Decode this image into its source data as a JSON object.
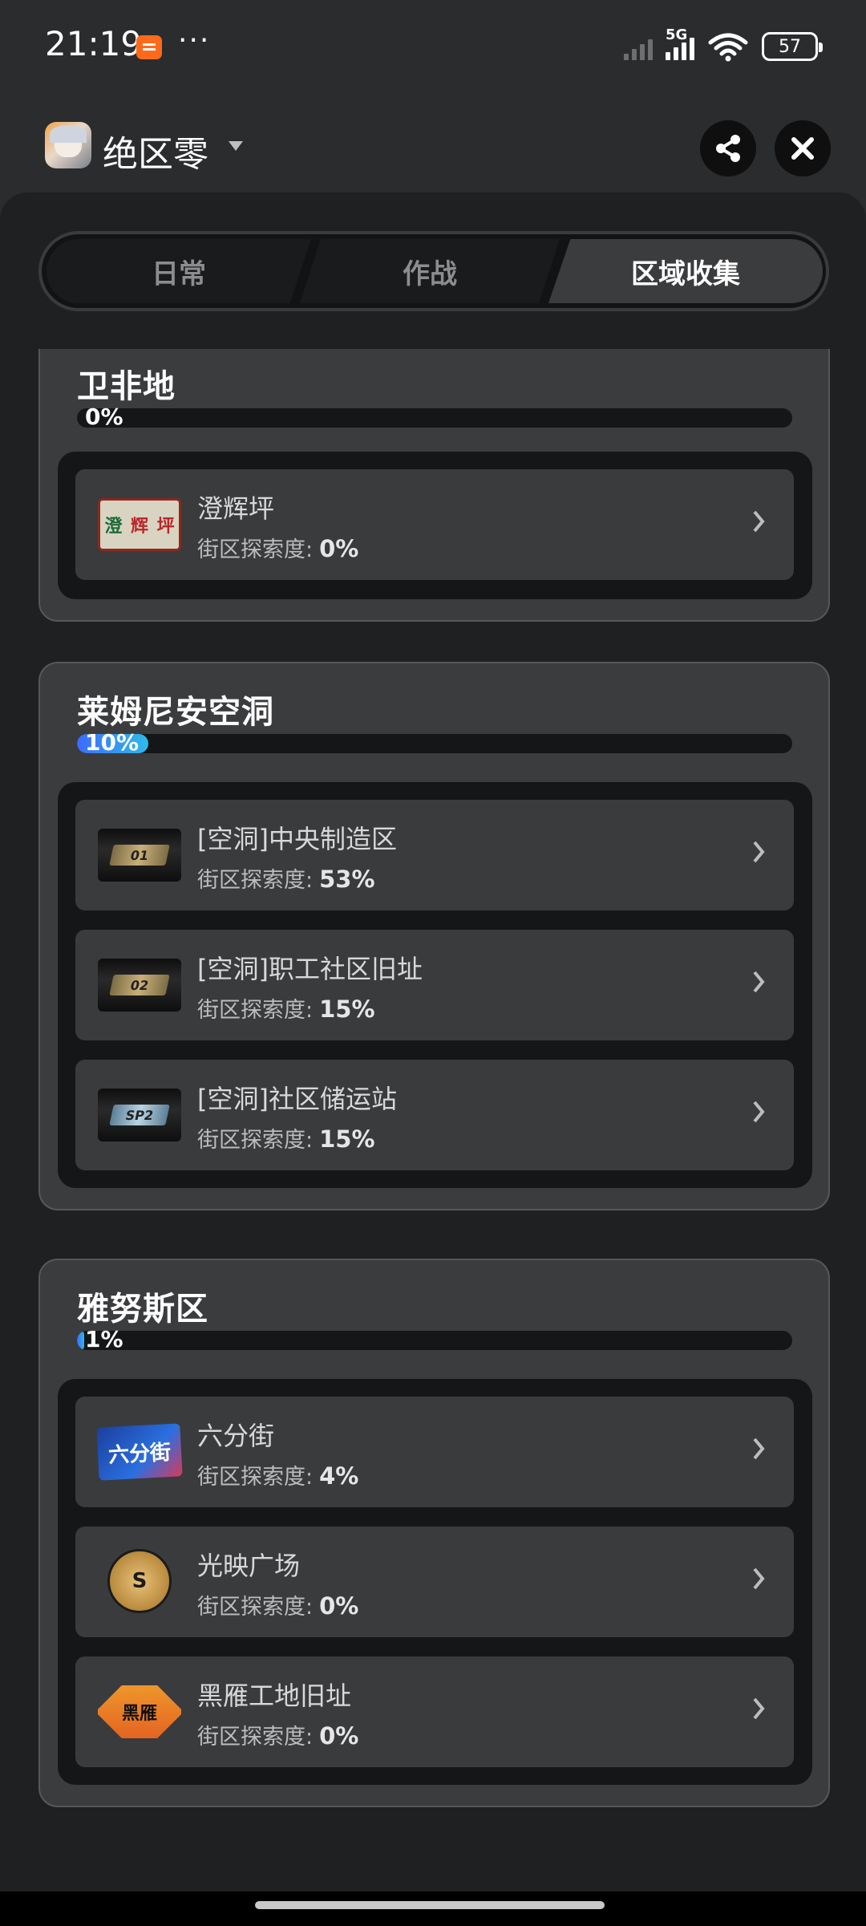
{
  "status_bar": {
    "time": "21:19",
    "dots": "···",
    "network": "5G",
    "battery": "57",
    "icons": [
      "chat-app-icon",
      "signal-icon",
      "wifi-icon",
      "battery-icon"
    ]
  },
  "title_bar": {
    "title": "绝区零",
    "icons": [
      "game-avatar",
      "dropdown-caret-icon",
      "share-icon",
      "close-icon"
    ]
  },
  "tabs": [
    {
      "label": "日常",
      "active": false
    },
    {
      "label": "作战",
      "active": false
    },
    {
      "label": "区域收集",
      "active": true
    }
  ],
  "progress_label_prefix": "街区探索度:",
  "colors": {
    "panel": "#1f2021",
    "card": "#3b3c3e",
    "progress_start": "#3d6bff",
    "progress_end": "#2fb9e8"
  },
  "regions": [
    {
      "name": "卫非地",
      "progress_text": "0%",
      "progress": 0,
      "districts": [
        {
          "name": "澄辉坪",
          "progress": "0%",
          "icon": "chenghui-icon",
          "icon_text": [
            "澄",
            "辉",
            "坪"
          ]
        }
      ]
    },
    {
      "name": "莱姆尼安空洞",
      "progress_text": "10%",
      "progress": 0.1,
      "districts": [
        {
          "name": "[空洞]中央制造区",
          "progress": "53%",
          "icon": "hollow-zone-icon",
          "icon_text": "01"
        },
        {
          "name": "[空洞]职工社区旧址",
          "progress": "15%",
          "icon": "hollow-zone-icon",
          "icon_text": "02"
        },
        {
          "name": "[空洞]社区储运站",
          "progress": "15%",
          "icon": "hollow-zone-icon",
          "icon_text": "SP2"
        }
      ]
    },
    {
      "name": "雅努斯区",
      "progress_text": "1%",
      "progress": 0.01,
      "districts": [
        {
          "name": "六分街",
          "progress": "4%",
          "icon": "sixth-street-icon",
          "icon_text": "六分街"
        },
        {
          "name": "光映广场",
          "progress": "0%",
          "icon": "lumina-square-icon",
          "icon_text": "S"
        },
        {
          "name": "黑雁工地旧址",
          "progress": "0%",
          "icon": "heiyan-site-icon",
          "icon_text": "黑雁"
        }
      ]
    }
  ]
}
